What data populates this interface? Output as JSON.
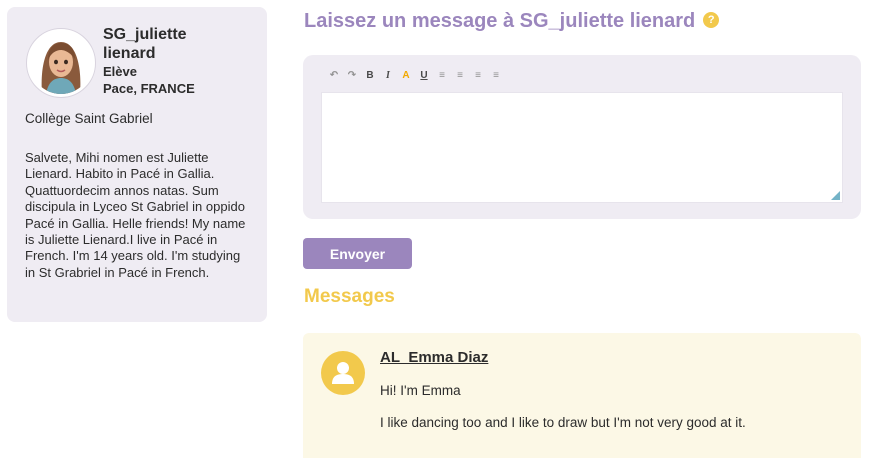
{
  "profile": {
    "name": "SG_juliette lienard",
    "role": "Elève",
    "location": "Pace, FRANCE",
    "school": "Collège Saint Gabriel",
    "bio": "Salvete, Mihi nomen est Juliette Lienard. Habito in Pacé in Gallia. Quattuordecim annos natas. Sum discipula in Lyceo St Gabriel in oppido Pacé in Gallia. Helle friends! My name is Juliette Lienard.I live in Pacé in French. I'm 14 years old. I'm studying in St Grabriel in Pacé in French."
  },
  "compose": {
    "title": "Laissez un message à SG_juliette lienard",
    "help_icon": "?",
    "toolbar": [
      {
        "name": "undo-icon",
        "glyph": "↶"
      },
      {
        "name": "redo-icon",
        "glyph": "↷"
      },
      {
        "name": "bold-icon",
        "glyph": "B"
      },
      {
        "name": "italic-icon",
        "glyph": "I"
      },
      {
        "name": "text-color-icon",
        "glyph": "A"
      },
      {
        "name": "underline-icon",
        "glyph": "U"
      },
      {
        "name": "align-left-icon",
        "glyph": "≡"
      },
      {
        "name": "align-center-icon",
        "glyph": "≡"
      },
      {
        "name": "align-right-icon",
        "glyph": "≡"
      },
      {
        "name": "align-justify-icon",
        "glyph": "≡"
      }
    ],
    "send_label": "Envoyer"
  },
  "messages": {
    "title": "Messages",
    "items": [
      {
        "author": "AL_Emma Diaz",
        "lines": [
          "Hi! I'm Emma",
          "I like dancing too and I like to draw but I'm not very good at it."
        ]
      }
    ]
  },
  "colors": {
    "accent": "#9b86bd",
    "messages_heading": "#f2c94c",
    "card_bg": "#efecf3",
    "message_bg": "#fcf8e6"
  }
}
